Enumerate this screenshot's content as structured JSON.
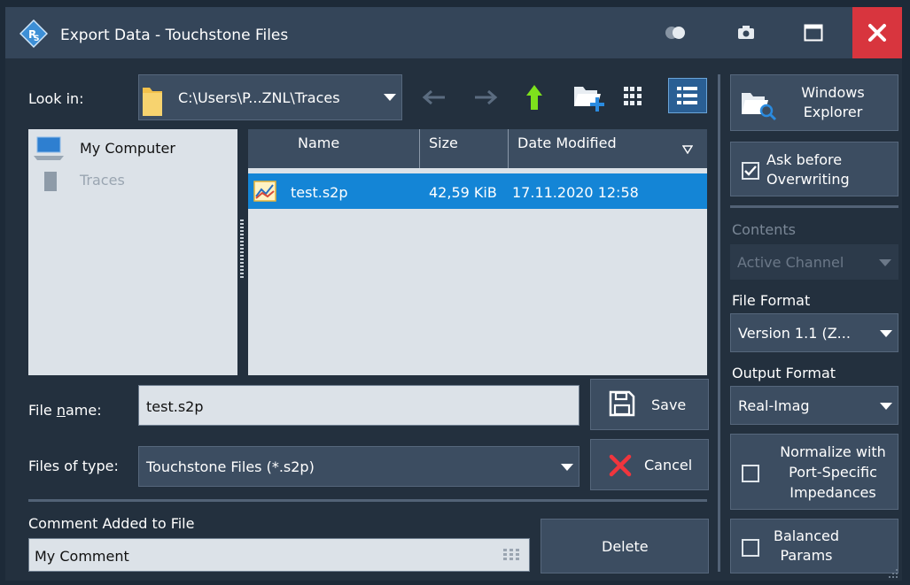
{
  "window": {
    "title": "Export Data - Touchstone Files",
    "colors": {
      "titlebar": "#344559",
      "background": "#23303e",
      "accent": "#1485d6",
      "close": "#d8353e"
    }
  },
  "title_icons": [
    "rs-logo-icon",
    "toggle-icon",
    "camera-icon",
    "maximize-icon",
    "close-icon"
  ],
  "look_in": {
    "label": "Look in:",
    "path": "C:\\Users\\P...ZNL\\Traces"
  },
  "nav_icons": [
    "back-arrow-icon",
    "forward-arrow-icon",
    "up-arrow-icon",
    "new-folder-icon",
    "list-view-icon",
    "detail-view-icon"
  ],
  "places": [
    {
      "label": "My Computer",
      "icon": "computer-icon",
      "enabled": true
    },
    {
      "label": "Traces",
      "icon": "folder-icon",
      "enabled": false
    }
  ],
  "file_table": {
    "columns": [
      "Name",
      "Size",
      "Date Modified"
    ],
    "rows": [
      {
        "name": "test.s2p",
        "size": "42,59 KiB",
        "date": "17.11.2020 12:58",
        "selected": true
      }
    ]
  },
  "file_name": {
    "label": "File name:",
    "value": "test.s2p"
  },
  "files_of_type": {
    "label": "Files of type:",
    "value": "Touchstone Files (*.s2p)"
  },
  "buttons": {
    "save": "Save",
    "cancel": "Cancel",
    "delete": "Delete",
    "windows_explorer": "Windows Explorer"
  },
  "comment": {
    "label": "Comment Added to File",
    "value": "My Comment"
  },
  "side": {
    "ask_before_overwriting": {
      "label": "Ask before Overwriting",
      "checked": true
    },
    "contents": {
      "label": "Contents",
      "value": "Active Channel",
      "enabled": false
    },
    "file_format": {
      "label": "File Format",
      "value": "Version 1.1 (Z..."
    },
    "output_format": {
      "label": "Output Format",
      "value": "Real-Imag"
    },
    "normalize": {
      "label": "Normalize with Port-Specific Impedances",
      "checked": false
    },
    "balanced": {
      "label": "Balanced Params",
      "checked": false
    }
  }
}
